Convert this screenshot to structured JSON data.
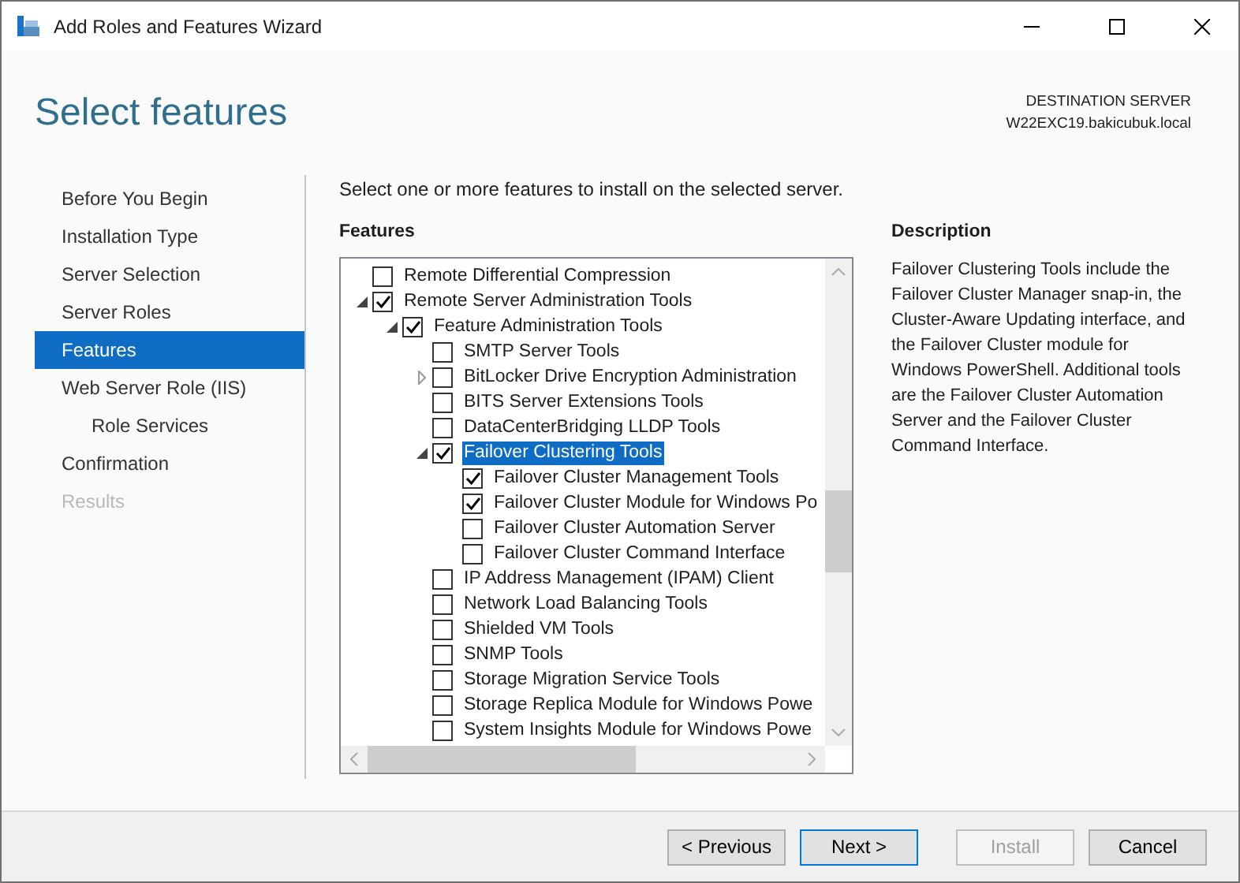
{
  "window": {
    "title": "Add Roles and Features Wizard"
  },
  "header": {
    "title": "Select features",
    "destination_label": "DESTINATION SERVER",
    "destination_server": "W22EXC19.bakicubuk.local"
  },
  "sidebar": {
    "items": [
      {
        "label": "Before You Begin",
        "selected": false,
        "disabled": false
      },
      {
        "label": "Installation Type",
        "selected": false,
        "disabled": false
      },
      {
        "label": "Server Selection",
        "selected": false,
        "disabled": false
      },
      {
        "label": "Server Roles",
        "selected": false,
        "disabled": false
      },
      {
        "label": "Features",
        "selected": true,
        "disabled": false
      },
      {
        "label": "Web Server Role (IIS)",
        "selected": false,
        "disabled": false,
        "children": [
          {
            "label": "Role Services",
            "selected": false,
            "disabled": false
          }
        ]
      },
      {
        "label": "Confirmation",
        "selected": false,
        "disabled": false
      },
      {
        "label": "Results",
        "selected": false,
        "disabled": true
      }
    ]
  },
  "instruction": "Select one or more features to install on the selected server.",
  "features": {
    "heading": "Features",
    "items": [
      {
        "label": "Remote Differential Compression",
        "checked": false,
        "selected": false
      },
      {
        "label": "Remote Server Administration Tools",
        "checked": true,
        "selected": false,
        "expanded": true,
        "children": [
          {
            "label": "Feature Administration Tools",
            "checked": true,
            "selected": false,
            "expanded": true,
            "children": [
              {
                "label": "SMTP Server Tools",
                "checked": false,
                "selected": false
              },
              {
                "label": "BitLocker Drive Encryption Administration",
                "checked": false,
                "selected": false,
                "expanded": false
              },
              {
                "label": "BITS Server Extensions Tools",
                "checked": false,
                "selected": false
              },
              {
                "label": "DataCenterBridging LLDP Tools",
                "checked": false,
                "selected": false
              },
              {
                "label": "Failover Clustering Tools",
                "checked": true,
                "selected": true,
                "expanded": true,
                "children": [
                  {
                    "label": "Failover Cluster Management Tools",
                    "checked": true,
                    "selected": false
                  },
                  {
                    "label": "Failover Cluster Module for Windows Po",
                    "checked": true,
                    "selected": false
                  },
                  {
                    "label": "Failover Cluster Automation Server",
                    "checked": false,
                    "selected": false
                  },
                  {
                    "label": "Failover Cluster Command Interface",
                    "checked": false,
                    "selected": false
                  }
                ]
              },
              {
                "label": "IP Address Management (IPAM) Client",
                "checked": false,
                "selected": false
              },
              {
                "label": "Network Load Balancing Tools",
                "checked": false,
                "selected": false
              },
              {
                "label": "Shielded VM Tools",
                "checked": false,
                "selected": false
              },
              {
                "label": "SNMP Tools",
                "checked": false,
                "selected": false
              },
              {
                "label": "Storage Migration Service Tools",
                "checked": false,
                "selected": false
              },
              {
                "label": "Storage Replica Module for Windows Powe",
                "checked": false,
                "selected": false
              },
              {
                "label": "System Insights Module for Windows Powe",
                "checked": false,
                "selected": false
              }
            ]
          }
        ]
      }
    ]
  },
  "description": {
    "heading": "Description",
    "text": "Failover Clustering Tools include the Failover Cluster Manager snap-in, the Cluster-Aware Updating interface, and the Failover Cluster module for Windows PowerShell. Additional tools are the Failover Cluster Automation Server and the Failover Cluster Command Interface."
  },
  "buttons": [
    {
      "label": "< Previous",
      "kind": "normal",
      "disabled": false
    },
    {
      "label": "Next >",
      "kind": "default",
      "disabled": false
    },
    {
      "label": "Install",
      "kind": "normal",
      "disabled": true
    },
    {
      "label": "Cancel",
      "kind": "normal",
      "disabled": false
    }
  ]
}
